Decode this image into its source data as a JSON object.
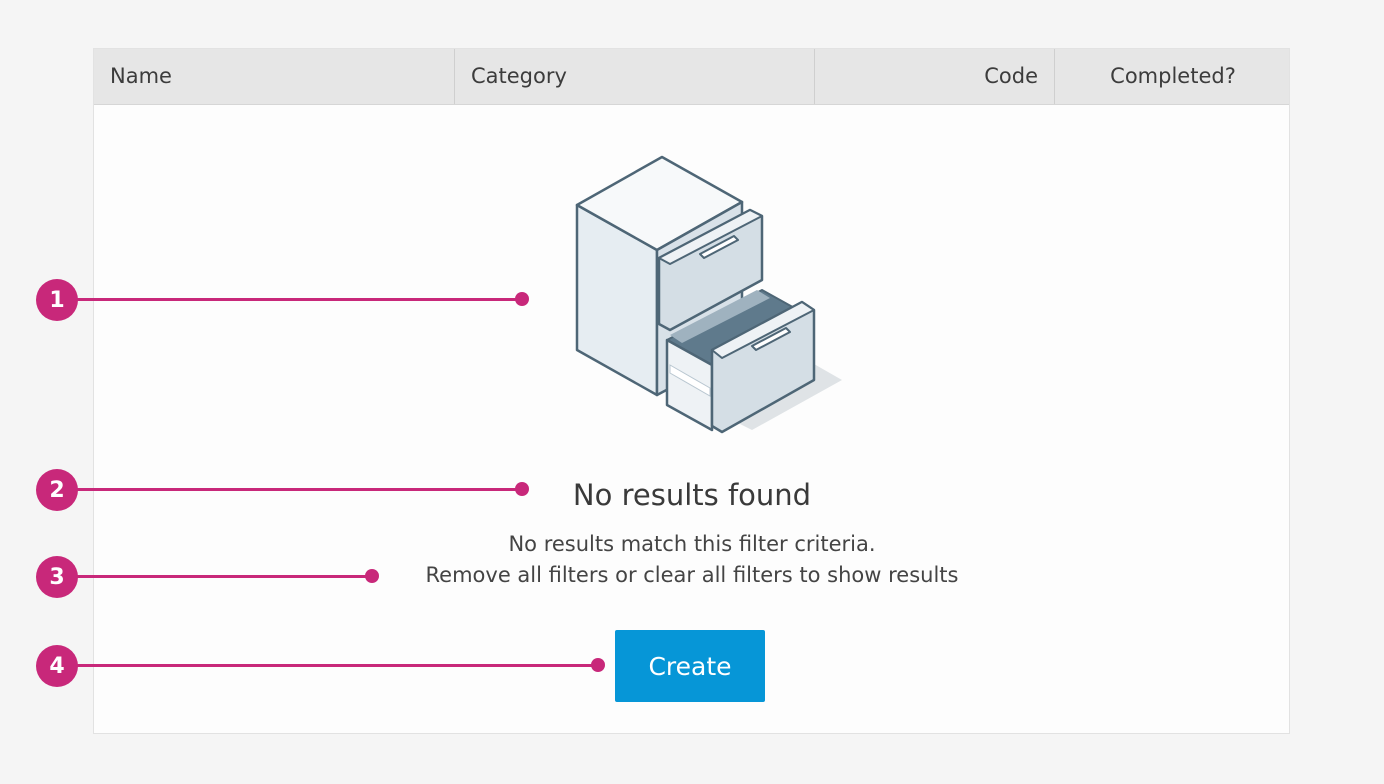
{
  "table": {
    "columns": [
      "Name",
      "Category",
      "Code",
      "Completed?"
    ]
  },
  "empty_state": {
    "illustration": "file-cabinet-illustration",
    "title": "No results found",
    "description_line1": "No results match this filter criteria.",
    "description_line2": "Remove all filters or clear all filters to show results",
    "create_label": "Create"
  },
  "callouts": [
    "1",
    "2",
    "3",
    "4"
  ],
  "colors": {
    "accent": "#0696d7",
    "callout": "#c8287a",
    "header_bg": "#e6e6e6",
    "page_bg": "#f5f5f5"
  }
}
